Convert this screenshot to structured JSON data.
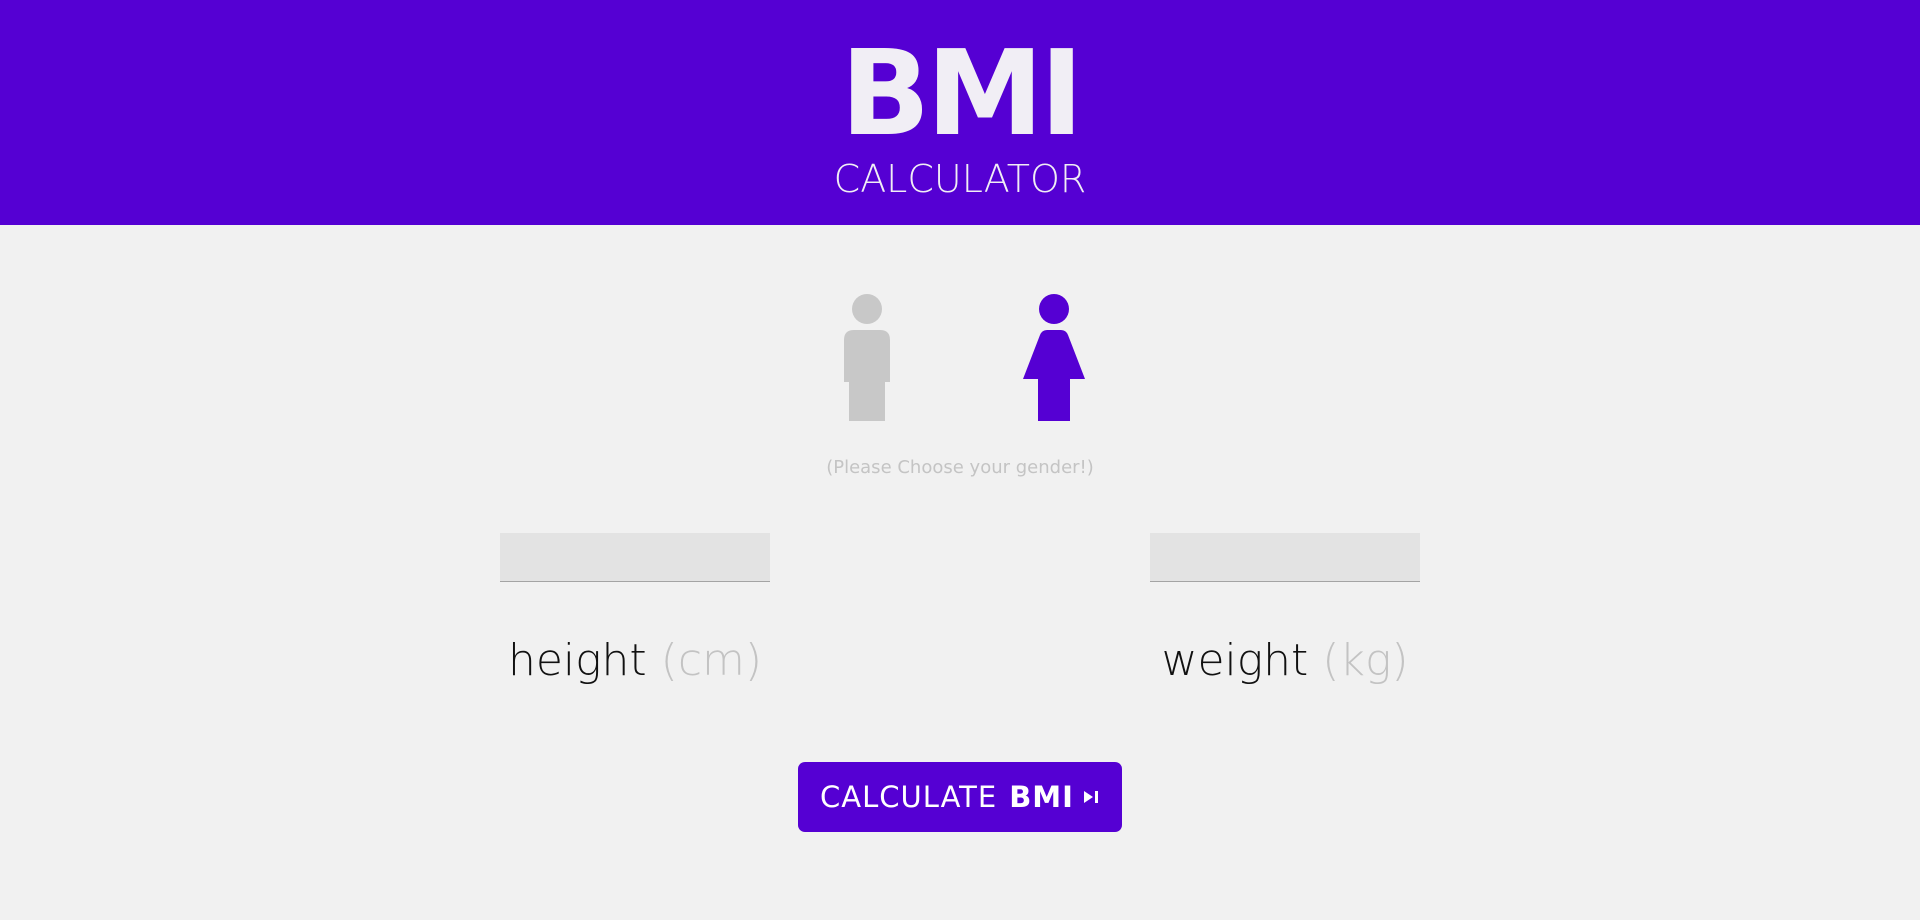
{
  "header": {
    "title": "BMI",
    "subtitle": "CALCULATOR",
    "background": "#5500d3"
  },
  "gender": {
    "options": [
      {
        "id": "male",
        "icon": "male-icon",
        "color": "#c8c8c8",
        "selected": false
      },
      {
        "id": "female",
        "icon": "female-icon",
        "color": "#5500d3",
        "selected": true
      }
    ],
    "hint": "(Please Choose your gender!)"
  },
  "inputs": {
    "height": {
      "value": "",
      "label": "height",
      "unit": "(cm)"
    },
    "weight": {
      "value": "",
      "label": "weight",
      "unit": "(kg)"
    }
  },
  "calculate_button": {
    "label": "CALCULATE",
    "label_bold": "BMI",
    "icon": "play-next-icon",
    "color": "#5500d3"
  },
  "colors": {
    "accent": "#5500d3",
    "background": "#f1f1f1",
    "muted": "#c4c4c4"
  }
}
